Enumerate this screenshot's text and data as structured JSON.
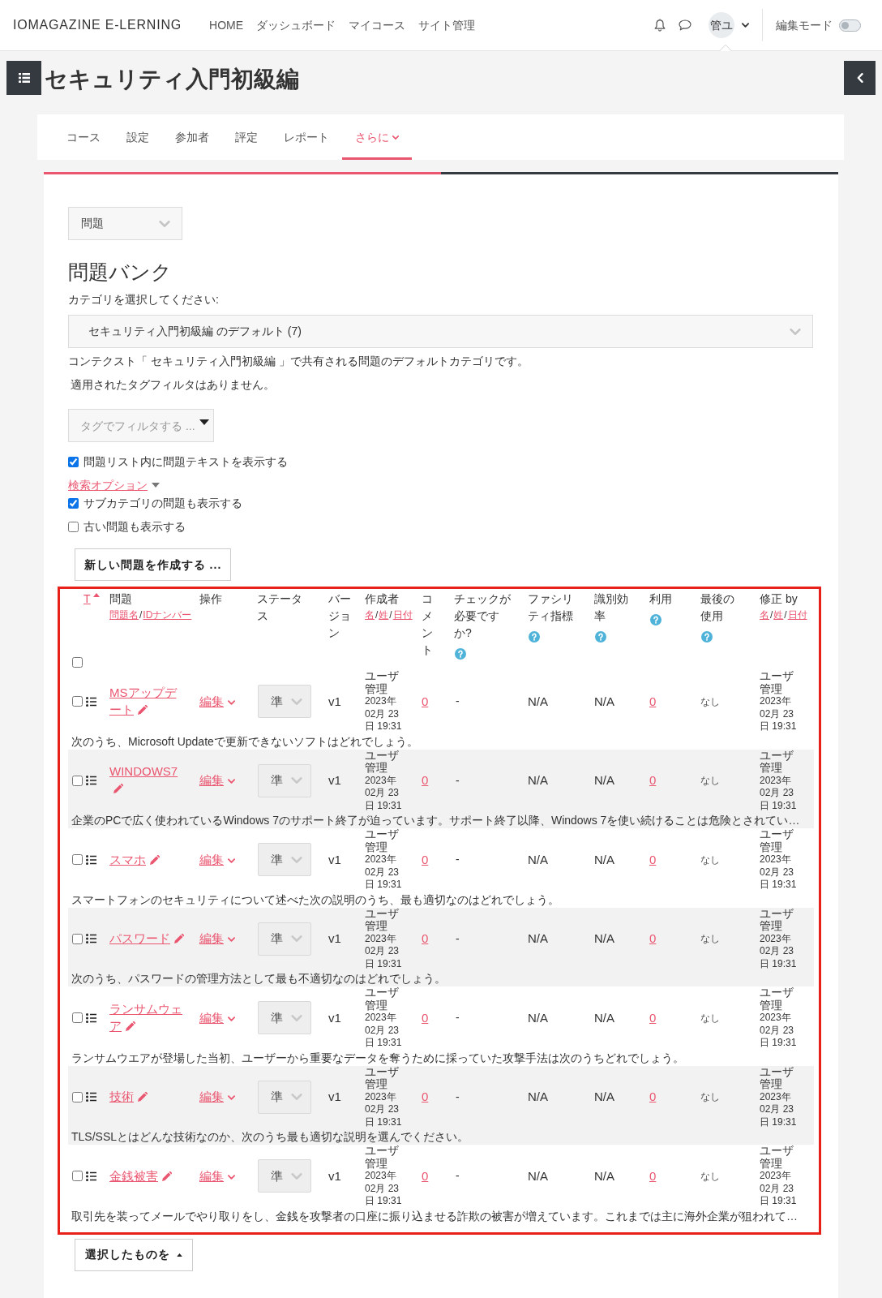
{
  "header": {
    "site_name": "IOMAGAZINE E-LERNING",
    "nav": [
      "HOME",
      "ダッシュボード",
      "マイコース",
      "サイト管理"
    ],
    "user_initials": "管ユ",
    "edit_mode": {
      "label": "編集モード",
      "on": false
    }
  },
  "course_title": "セキュリティ入門初級編",
  "tabs": [
    {
      "label": "コース",
      "selected": false,
      "dropdown": false
    },
    {
      "label": "設定",
      "selected": false,
      "dropdown": false
    },
    {
      "label": "参加者",
      "selected": false,
      "dropdown": false
    },
    {
      "label": "評定",
      "selected": false,
      "dropdown": false
    },
    {
      "label": "レポート",
      "selected": false,
      "dropdown": false
    },
    {
      "label": "さらに",
      "selected": true,
      "dropdown": true
    }
  ],
  "course_progress": {
    "level": 0.5
  },
  "page_select": {
    "value": "問題"
  },
  "heading": "問題バンク",
  "category": {
    "label": "カテゴリを選択してください:",
    "value": "セキュリティ入門初級編 のデフォルト (7)",
    "description": "コンテクスト「 セキュリティ入門初級編 」で共有される問題のデフォルトカテゴリです。"
  },
  "tag_filter_note": "適用されたタグフィルタはありません。",
  "tag_filter": {
    "placeholder": "タグでフィルタする ..."
  },
  "show_text_option": {
    "label": "問題リスト内に問題テキストを表示する",
    "checked": true
  },
  "search_options": {
    "label": "検索オプション",
    "expanded": true,
    "options": [
      {
        "label": "サブカテゴリの問題も表示する",
        "checked": true
      },
      {
        "label": "古い問題も表示する",
        "checked": false
      }
    ]
  },
  "create_button": "新しい問題を作成する ...",
  "table": {
    "select_all": {
      "checked": false
    },
    "columns": [
      {
        "kind": "sort",
        "label": "T",
        "sorted": true,
        "help": false
      },
      {
        "kind": "text",
        "label": "問題",
        "help": false,
        "sort_links": [
          {
            "kind": "link",
            "text": "問題名"
          },
          {
            "kind": "separator",
            "text": "/"
          },
          {
            "kind": "link",
            "text": "IDナンバー"
          }
        ]
      },
      {
        "kind": "text",
        "label": "操作",
        "help": false
      },
      {
        "kind": "text",
        "label": "ステータス",
        "help": false
      },
      {
        "kind": "text",
        "label": "バージョン",
        "help": false
      },
      {
        "kind": "text",
        "label": "作成者",
        "help": false,
        "sort_links": [
          {
            "kind": "link",
            "text": "名"
          },
          {
            "kind": "separator",
            "text": "/"
          },
          {
            "kind": "link",
            "text": "姓"
          },
          {
            "kind": "separator",
            "text": "/"
          },
          {
            "kind": "link",
            "text": "日付"
          }
        ]
      },
      {
        "kind": "text",
        "label": "コメント",
        "help": false
      },
      {
        "kind": "text",
        "label": "チェックが必要ですか?",
        "help": true
      },
      {
        "kind": "text",
        "label": "ファシリティ指標",
        "help": true
      },
      {
        "kind": "text",
        "label": "識別効率",
        "help": true
      },
      {
        "kind": "text",
        "label": "利用",
        "help": true
      },
      {
        "kind": "text",
        "label": "最後の使用",
        "help": true
      },
      {
        "kind": "text",
        "label": "修正 by",
        "help": false,
        "sort_links": [
          {
            "kind": "link",
            "text": "名"
          },
          {
            "kind": "separator",
            "text": "/"
          },
          {
            "kind": "link",
            "text": "姓"
          },
          {
            "kind": "separator",
            "text": "/"
          },
          {
            "kind": "link",
            "text": "日付"
          }
        ]
      }
    ],
    "rows": [
      {
        "checked": false,
        "name": "MSアップデート",
        "action": "編集",
        "status": "準",
        "version": "v1",
        "created_by": "ユーザ管理",
        "created_date": "2023年 02月 23日 19:31",
        "comments": "0",
        "needs_checking": "-",
        "facility_index": "N/A",
        "discrimination_efficiency": "N/A",
        "usage": "0",
        "last_used": "なし",
        "modified_by": "ユーザ管理",
        "modified_date": "2023年 02月 23日 19:31",
        "text": "次のうち、Microsoft Updateで更新できないソフトはどれでしょう。"
      },
      {
        "checked": false,
        "name": "WINDOWS7",
        "action": "編集",
        "status": "準",
        "version": "v1",
        "created_by": "ユーザ管理",
        "created_date": "2023年 02月 23日 19:31",
        "comments": "0",
        "needs_checking": "-",
        "facility_index": "N/A",
        "discrimination_efficiency": "N/A",
        "usage": "0",
        "last_used": "なし",
        "modified_by": "ユーザ管理",
        "modified_date": "2023年 02月 23日 19:31",
        "text": "企業のPCで広く使われているWindows 7のサポート終了が迫っています。サポート終了以降、Windows 7を使い続けることは危険とされてい…"
      },
      {
        "checked": false,
        "name": "スマホ",
        "action": "編集",
        "status": "準",
        "version": "v1",
        "created_by": "ユーザ管理",
        "created_date": "2023年 02月 23日 19:31",
        "comments": "0",
        "needs_checking": "-",
        "facility_index": "N/A",
        "discrimination_efficiency": "N/A",
        "usage": "0",
        "last_used": "なし",
        "modified_by": "ユーザ管理",
        "modified_date": "2023年 02月 23日 19:31",
        "text": "スマートフォンのセキュリティについて述べた次の説明のうち、最も適切なのはどれでしょう。"
      },
      {
        "checked": false,
        "name": "パスワード",
        "action": "編集",
        "status": "準",
        "version": "v1",
        "created_by": "ユーザ管理",
        "created_date": "2023年 02月 23日 19:31",
        "comments": "0",
        "needs_checking": "-",
        "facility_index": "N/A",
        "discrimination_efficiency": "N/A",
        "usage": "0",
        "last_used": "なし",
        "modified_by": "ユーザ管理",
        "modified_date": "2023年 02月 23日 19:31",
        "text": "次のうち、パスワードの管理方法として最も不適切なのはどれでしょう。"
      },
      {
        "checked": false,
        "name": "ランサムウェア",
        "action": "編集",
        "status": "準",
        "version": "v1",
        "created_by": "ユーザ管理",
        "created_date": "2023年 02月 23日 19:31",
        "comments": "0",
        "needs_checking": "-",
        "facility_index": "N/A",
        "discrimination_efficiency": "N/A",
        "usage": "0",
        "last_used": "なし",
        "modified_by": "ユーザ管理",
        "modified_date": "2023年 02月 23日 19:31",
        "text": "ランサムウエアが登場した当初、ユーザーから重要なデータを奪うために採っていた攻撃手法は次のうちどれでしょう。"
      },
      {
        "checked": false,
        "name": "技術",
        "action": "編集",
        "status": "準",
        "version": "v1",
        "created_by": "ユーザ管理",
        "created_date": "2023年 02月 23日 19:31",
        "comments": "0",
        "needs_checking": "-",
        "facility_index": "N/A",
        "discrimination_efficiency": "N/A",
        "usage": "0",
        "last_used": "なし",
        "modified_by": "ユーザ管理",
        "modified_date": "2023年 02月 23日 19:31",
        "text": "TLS/SSLとはどんな技術なのか、次のうち最も適切な説明を選んでください。"
      },
      {
        "checked": false,
        "name": "金銭被害",
        "action": "編集",
        "status": "準",
        "version": "v1",
        "created_by": "ユーザ管理",
        "created_date": "2023年 02月 23日 19:31",
        "comments": "0",
        "needs_checking": "-",
        "facility_index": "N/A",
        "discrimination_efficiency": "N/A",
        "usage": "0",
        "last_used": "なし",
        "modified_by": "ユーザ管理",
        "modified_date": "2023年 02月 23日 19:31",
        "text": "取引先を装ってメールでやり取りをし、金銭を攻撃者の口座に振り込ませる詐欺の被害が増えています。これまでは主に海外企業が狙われて…"
      }
    ]
  },
  "bulk_button": "選択したものを"
}
